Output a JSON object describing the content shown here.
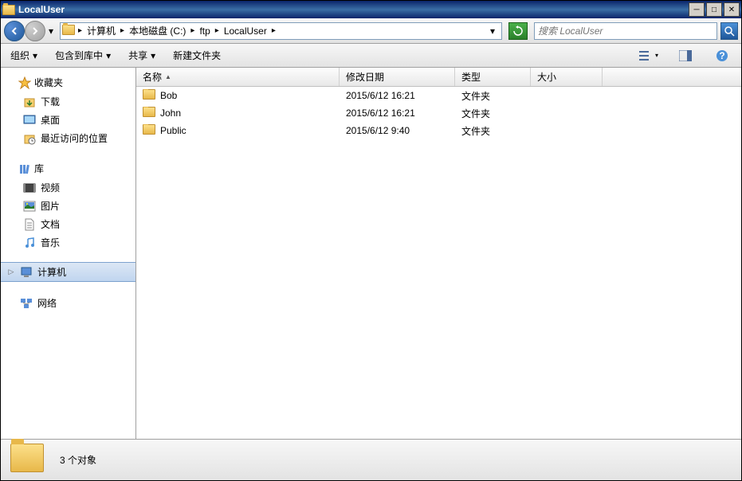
{
  "window": {
    "title": "LocalUser"
  },
  "nav": {
    "path_segments": [
      "计算机",
      "本地磁盘 (C:)",
      "ftp",
      "LocalUser"
    ],
    "search_placeholder": "搜索 LocalUser"
  },
  "toolbar": {
    "organize": "组织",
    "include": "包含到库中",
    "share": "共享",
    "new_folder": "新建文件夹"
  },
  "sidebar": {
    "favorites": {
      "label": "收藏夹",
      "items": [
        {
          "label": "下载",
          "icon": "download-icon"
        },
        {
          "label": "桌面",
          "icon": "desktop-icon"
        },
        {
          "label": "最近访问的位置",
          "icon": "recent-icon"
        }
      ]
    },
    "libraries": {
      "label": "库",
      "items": [
        {
          "label": "视频",
          "icon": "video-icon"
        },
        {
          "label": "图片",
          "icon": "picture-icon"
        },
        {
          "label": "文档",
          "icon": "document-icon"
        },
        {
          "label": "音乐",
          "icon": "music-icon"
        }
      ]
    },
    "computer": {
      "label": "计算机"
    },
    "network": {
      "label": "网络"
    }
  },
  "columns": {
    "name": "名称",
    "modified": "修改日期",
    "type": "类型",
    "size": "大小",
    "widths": {
      "name": 255,
      "modified": 145,
      "type": 95,
      "size": 90
    }
  },
  "files": [
    {
      "name": "Bob",
      "modified": "2015/6/12 16:21",
      "type": "文件夹",
      "size": ""
    },
    {
      "name": "John",
      "modified": "2015/6/12 16:21",
      "type": "文件夹",
      "size": ""
    },
    {
      "name": "Public",
      "modified": "2015/6/12 9:40",
      "type": "文件夹",
      "size": ""
    }
  ],
  "status": {
    "text": "3 个对象"
  }
}
